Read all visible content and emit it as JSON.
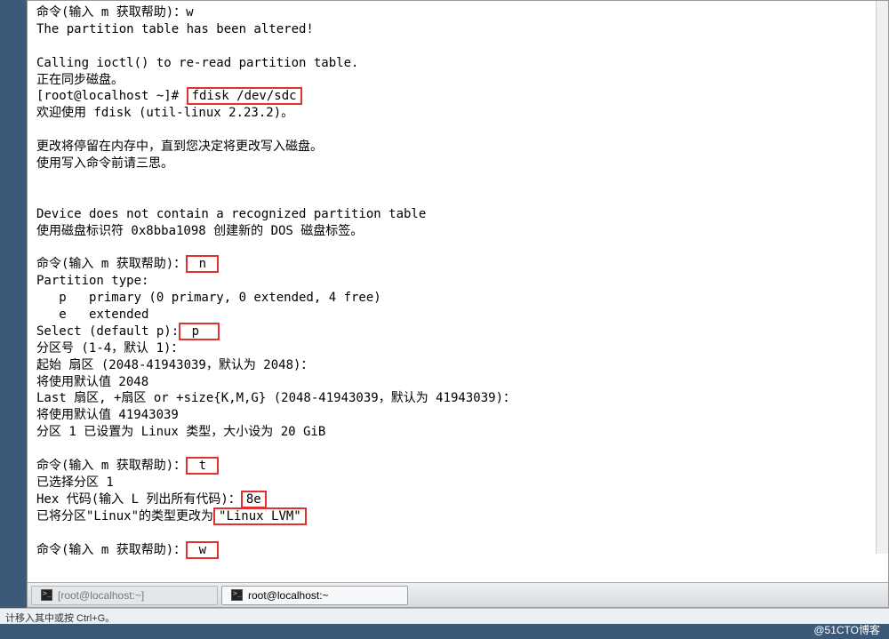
{
  "terminal": {
    "l01": "命令(输入 m 获取帮助)：w",
    "l02": "The partition table has been altered!",
    "l03": "",
    "l04": "Calling ioctl() to re-read partition table.",
    "l05": "正在同步磁盘。",
    "l06a": "[root@localhost ~]# ",
    "l06b": "fdisk /dev/sdc",
    "l07": "欢迎使用 fdisk (util-linux 2.23.2)。",
    "l08": "",
    "l09": "更改将停留在内存中，直到您决定将更改写入磁盘。",
    "l10": "使用写入命令前请三思。",
    "l11": "",
    "l12": "",
    "l13": "Device does not contain a recognized partition table",
    "l14": "使用磁盘标识符 0x8bba1098 创建新的 DOS 磁盘标签。",
    "l15": "",
    "l16a": "命令(输入 m 获取帮助)：",
    "l16b": " n ",
    "l17": "Partition type:",
    "l18": "   p   primary (0 primary, 0 extended, 4 free)",
    "l19": "   e   extended",
    "l20a": "Select (default p):",
    "l20b": " p  ",
    "l21": "分区号 (1-4，默认 1)：",
    "l22": "起始 扇区 (2048-41943039，默认为 2048)：",
    "l23": "将使用默认值 2048",
    "l24": "Last 扇区, +扇区 or +size{K,M,G} (2048-41943039，默认为 41943039)：",
    "l25": "将使用默认值 41943039",
    "l26": "分区 1 已设置为 Linux 类型，大小设为 20 GiB",
    "l27": "",
    "l28a": "命令(输入 m 获取帮助)：",
    "l28b": " t ",
    "l29": "已选择分区 1",
    "l30a": "Hex 代码(输入 L 列出所有代码)：",
    "l30b": "8e",
    "l31a": "已将分区\"Linux\"的类型更改为",
    "l31b": "\"Linux LVM\"",
    "l32": "",
    "l33a": "命令(输入 m 获取帮助)：",
    "l33b": " w "
  },
  "taskbar": {
    "tab1": "[root@localhost:~]",
    "tab2": "root@localhost:~"
  },
  "statusbar": "计移入其中或按 Ctrl+G。",
  "watermark": "@51CTO博客"
}
